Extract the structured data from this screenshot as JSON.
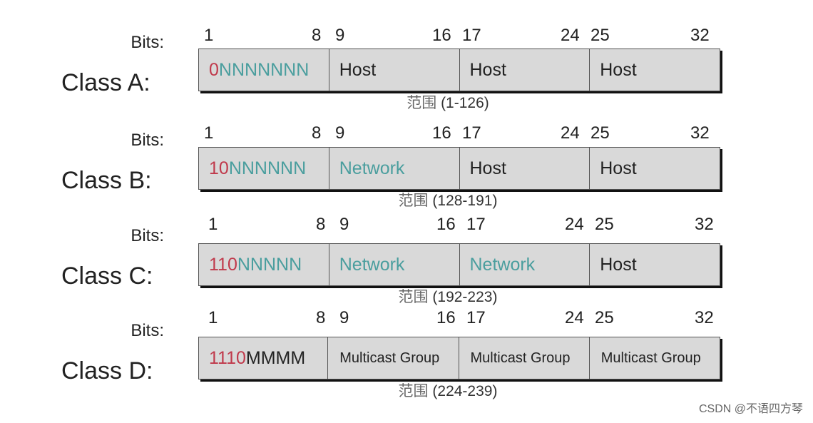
{
  "bits_label": "Bits:",
  "bit_numbers": [
    "1",
    "8",
    "9",
    "16",
    "17",
    "24",
    "25",
    "32"
  ],
  "colors": {
    "prefix": "#c0394b",
    "network": "#4a9e9e",
    "host": "#222222",
    "cell_bg": "#d9d9d9"
  },
  "classes": [
    {
      "label": "Class A:",
      "prefix": "0",
      "prefix_rest": "NNNNNNN",
      "rest_color": "network",
      "cells": [
        {
          "text": "Host",
          "kind": "host"
        },
        {
          "text": "Host",
          "kind": "host"
        },
        {
          "text": "Host",
          "kind": "host"
        }
      ],
      "range_cn": "范围",
      "range": "(1-126)"
    },
    {
      "label": "Class B:",
      "prefix": "10",
      "prefix_rest": "NNNNNN",
      "rest_color": "network",
      "cells": [
        {
          "text": "Network",
          "kind": "network"
        },
        {
          "text": "Host",
          "kind": "host"
        },
        {
          "text": "Host",
          "kind": "host"
        }
      ],
      "range_cn": "范围",
      "range": "(128-191)"
    },
    {
      "label": "Class C:",
      "prefix": "110",
      "prefix_rest": "NNNNN",
      "rest_color": "network",
      "cells": [
        {
          "text": "Network",
          "kind": "network"
        },
        {
          "text": "Network",
          "kind": "network"
        },
        {
          "text": "Host",
          "kind": "host"
        }
      ],
      "range_cn": "范围",
      "range": "(192-223)"
    },
    {
      "label": "Class D:",
      "prefix": "1110",
      "prefix_rest": "MMMM",
      "rest_color": "host",
      "cells": [
        {
          "text": "Multicast Group",
          "kind": "host"
        },
        {
          "text": "Multicast Group",
          "kind": "host"
        },
        {
          "text": "Multicast Group",
          "kind": "host"
        }
      ],
      "range_cn": "范围",
      "range": "(224-239)"
    }
  ],
  "watermark": "CSDN @不语四方琴"
}
